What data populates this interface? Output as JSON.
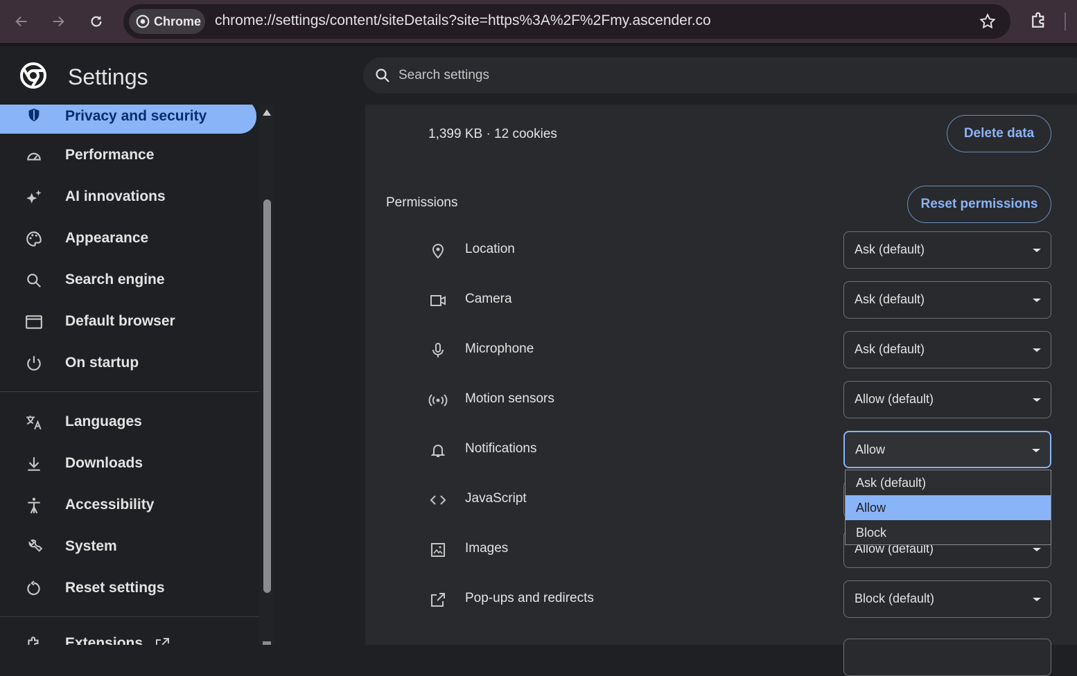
{
  "browser": {
    "chip_label": "Chrome",
    "url": "chrome://settings/content/siteDetails?site=https%3A%2F%2Fmy.ascender.co"
  },
  "header": {
    "title": "Settings",
    "search_placeholder": "Search settings"
  },
  "sidebar": {
    "items": [
      {
        "label": "Privacy and security",
        "icon": "shield-icon",
        "active": true
      },
      {
        "label": "Performance",
        "icon": "speedometer-icon"
      },
      {
        "label": "AI innovations",
        "icon": "sparkle-icon"
      },
      {
        "label": "Appearance",
        "icon": "palette-icon"
      },
      {
        "label": "Search engine",
        "icon": "search-icon"
      },
      {
        "label": "Default browser",
        "icon": "browser-window-icon"
      },
      {
        "label": "On startup",
        "icon": "power-icon"
      },
      {
        "label": "Languages",
        "icon": "translate-icon"
      },
      {
        "label": "Downloads",
        "icon": "download-icon"
      },
      {
        "label": "Accessibility",
        "icon": "accessibility-icon"
      },
      {
        "label": "System",
        "icon": "wrench-icon"
      },
      {
        "label": "Reset settings",
        "icon": "reset-icon"
      },
      {
        "label": "Extensions",
        "icon": "extension-icon"
      }
    ]
  },
  "site": {
    "usage": "1,399 KB · 12 cookies",
    "delete_label": "Delete data"
  },
  "permissions": {
    "heading": "Permissions",
    "reset_label": "Reset permissions",
    "rows": [
      {
        "label": "Location",
        "icon": "location-pin-icon",
        "value": "Ask (default)"
      },
      {
        "label": "Camera",
        "icon": "camera-icon",
        "value": "Ask (default)"
      },
      {
        "label": "Microphone",
        "icon": "microphone-icon",
        "value": "Ask (default)"
      },
      {
        "label": "Motion sensors",
        "icon": "motion-sensor-icon",
        "value": "Allow (default)"
      },
      {
        "label": "Notifications",
        "icon": "bell-icon",
        "value": "Allow"
      },
      {
        "label": "JavaScript",
        "icon": "code-icon",
        "value": ""
      },
      {
        "label": "Images",
        "icon": "image-icon",
        "value": "Allow (default)"
      },
      {
        "label": "Pop-ups and redirects",
        "icon": "open-external-icon",
        "value": "Block (default)"
      }
    ],
    "dropdown_options": [
      "Ask (default)",
      "Allow",
      "Block"
    ],
    "dropdown_selected": "Allow"
  },
  "colors": {
    "accent": "#8ab4f8",
    "titlebar": "#3c2f3a",
    "card": "#292a2d"
  }
}
